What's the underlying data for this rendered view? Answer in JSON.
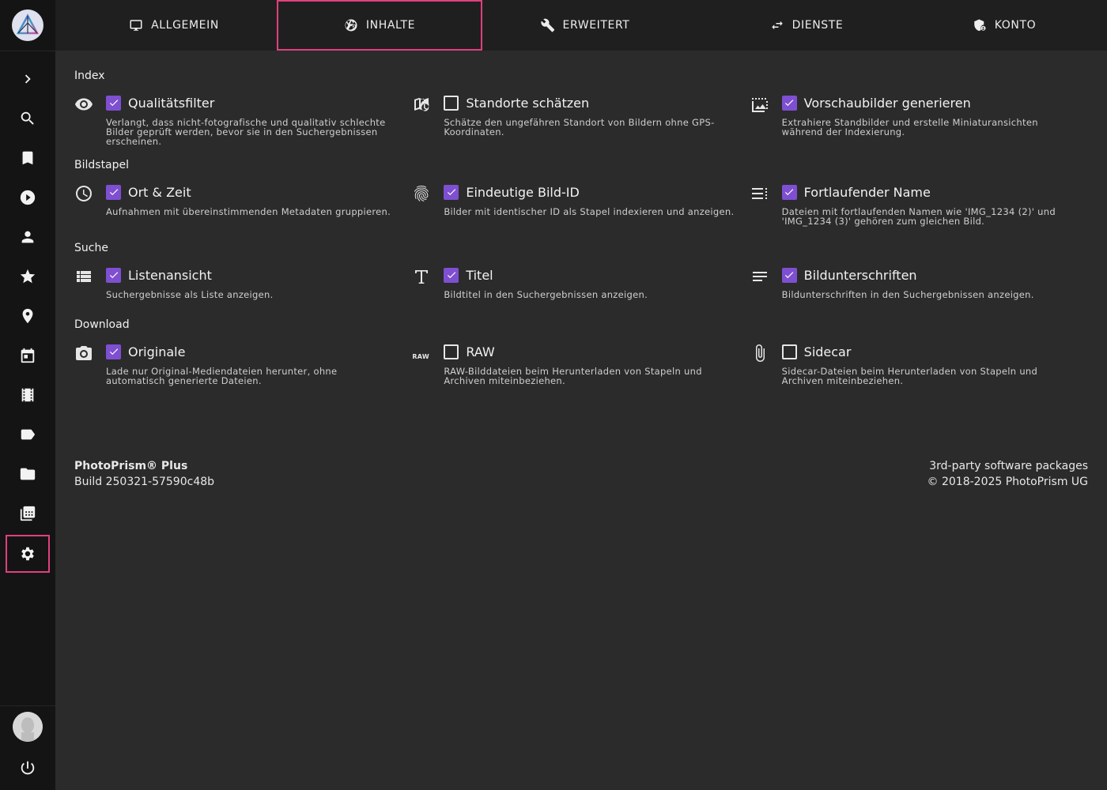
{
  "tabs": [
    {
      "label": "ALLGEMEIN",
      "icon": "monitor-icon"
    },
    {
      "label": "INHALTE",
      "icon": "aperture-icon"
    },
    {
      "label": "ERWEITERT",
      "icon": "wrench-icon"
    },
    {
      "label": "DIENSTE",
      "icon": "swap-icon"
    },
    {
      "label": "KONTO",
      "icon": "account-shield-icon"
    }
  ],
  "active_tab": "INHALTE",
  "sidebar": {
    "items": [
      "expand",
      "search",
      "albums",
      "videos",
      "people",
      "favorites",
      "places",
      "calendar",
      "moments",
      "labels",
      "folders",
      "library",
      "settings"
    ],
    "active": "settings"
  },
  "sections": {
    "index": {
      "title": "Index",
      "options": [
        {
          "label": "Qualitätsfilter",
          "checked": true,
          "icon": "eye-icon",
          "desc": "Verlangt, dass nicht-fotografische und qualitativ schlechte Bilder geprüft werden, bevor sie in den Suchergebnissen erscheinen."
        },
        {
          "label": "Standorte schätzen",
          "checked": false,
          "icon": "map-clock-icon",
          "desc": "Schätze den ungefähren Standort von Bildern ohne GPS-Koordinaten."
        },
        {
          "label": "Vorschaubilder generieren",
          "checked": true,
          "icon": "image-frame-icon",
          "desc": "Extrahiere Standbilder und erstelle Miniaturansichten während der Indexierung."
        }
      ]
    },
    "stacks": {
      "title": "Bildstapel",
      "options": [
        {
          "label": "Ort & Zeit",
          "checked": true,
          "icon": "clock-icon",
          "desc": "Aufnahmen mit übereinstimmenden Metadaten gruppieren."
        },
        {
          "label": "Eindeutige Bild-ID",
          "checked": true,
          "icon": "fingerprint-icon",
          "desc": "Bilder mit identischer ID als Stapel indexieren und anzeigen."
        },
        {
          "label": "Fortlaufender Name",
          "checked": true,
          "icon": "format-list-icon",
          "desc": "Dateien mit fortlaufenden Namen wie 'IMG_1234 (2)' und 'IMG_1234 (3)' gehören zum gleichen Bild."
        }
      ]
    },
    "search": {
      "title": "Suche",
      "options": [
        {
          "label": "Listenansicht",
          "checked": true,
          "icon": "view-list-icon",
          "desc": "Suchergebnisse als Liste anzeigen."
        },
        {
          "label": "Titel",
          "checked": true,
          "icon": "text-t-icon",
          "desc": "Bildtitel in den Suchergebnissen anzeigen."
        },
        {
          "label": "Bildunterschriften",
          "checked": true,
          "icon": "subject-lines-icon",
          "desc": "Bildunterschriften in den Suchergebnissen anzeigen."
        }
      ]
    },
    "download": {
      "title": "Download",
      "options": [
        {
          "label": "Originale",
          "checked": true,
          "icon": "camera-icon",
          "desc": "Lade nur Original-Mediendateien herunter, ohne automatisch generierte Dateien."
        },
        {
          "label": "RAW",
          "checked": false,
          "icon": "raw-icon",
          "icon_text": "RAW",
          "desc": "RAW-Bilddateien beim Herunterladen von Stapeln und Archiven miteinbeziehen."
        },
        {
          "label": "Sidecar",
          "checked": false,
          "icon": "paperclip-icon",
          "desc": "Sidecar-Dateien beim Herunterladen von Stapeln und Archiven miteinbeziehen."
        }
      ]
    }
  },
  "footer": {
    "product": "PhotoPrism® Plus",
    "build": "Build 250321-57590c48b",
    "packages": "3rd-party software packages",
    "copyright": "© 2018-2025 PhotoPrism UG"
  },
  "colors": {
    "accent": "#7e4fd1",
    "highlight": "#e0407e",
    "background": "#2b2b2c",
    "sidebar": "#141414",
    "tabbar": "#1f1f1f"
  }
}
